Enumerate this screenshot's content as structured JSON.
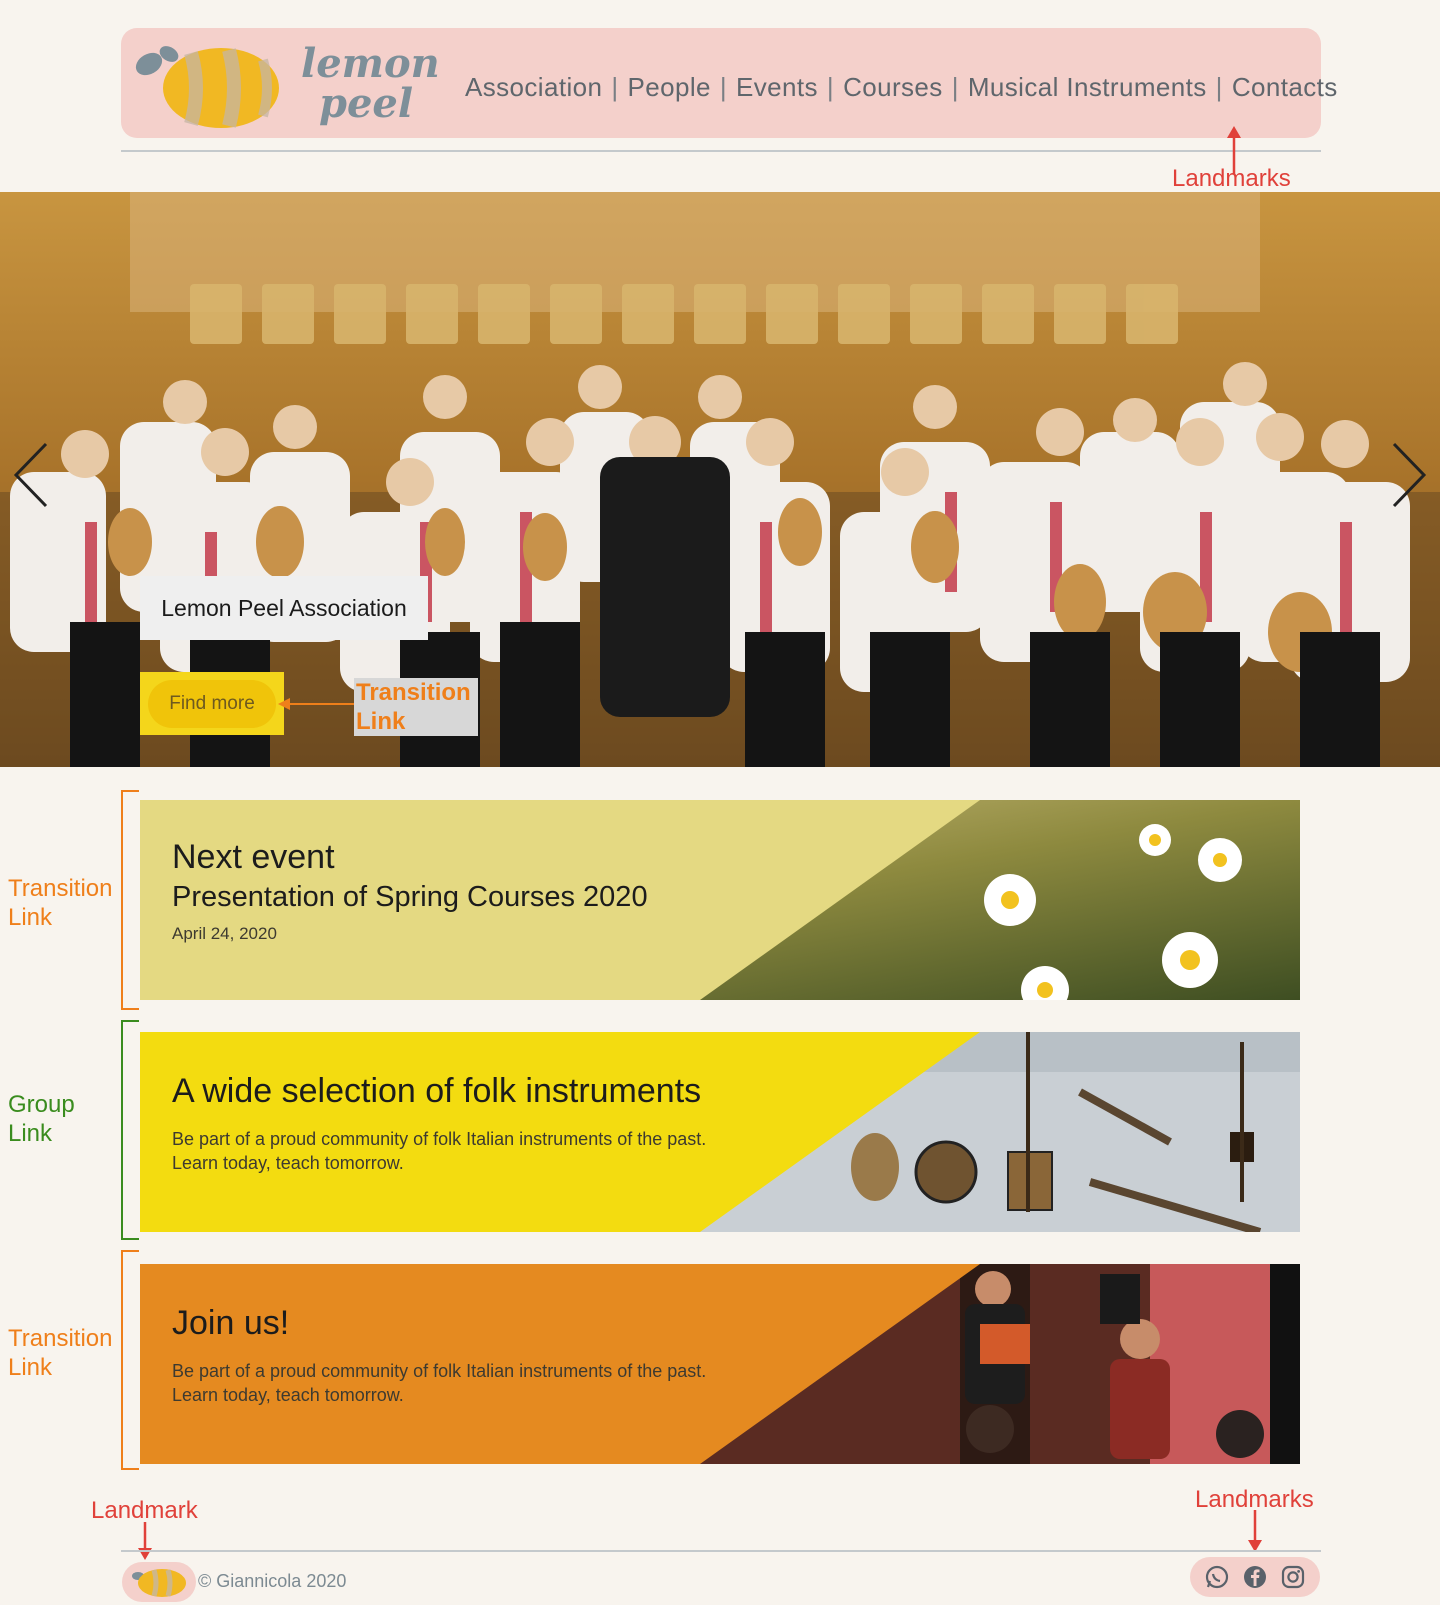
{
  "header": {
    "logo_text_line1": "lemon",
    "logo_text_line2": "peel",
    "nav": [
      "Association",
      "People",
      "Events",
      "Courses",
      "Musical Instruments",
      "Contacts"
    ],
    "separator": "|"
  },
  "hero": {
    "title": "Lemon Peel Association",
    "button_label": "Find more",
    "prev_label": "‹",
    "next_label": "›"
  },
  "cards": [
    {
      "heading": "Next event",
      "subheading": "Presentation of Spring Courses 2020",
      "date": "April 24, 2020",
      "color": "#e4d982"
    },
    {
      "heading": "A wide selection of folk instruments",
      "body_line1": "Be part of a proud community of folk Italian instruments of the past.",
      "body_line2": "Learn today, teach tomorrow.",
      "color": "#f3dc10"
    },
    {
      "heading": "Join us!",
      "body_line1": "Be part of a proud community of folk Italian instruments of the past.",
      "body_line2": "Learn today, teach tomorrow.",
      "color": "#e58a20"
    }
  ],
  "annotations": {
    "landmarks_top": "Landmarks",
    "transition_link_hero_1": "Transition",
    "transition_link_hero_2": "Link",
    "card1_label_1": "Transition",
    "card1_label_2": "Link",
    "card2_label_1": "Group",
    "card2_label_2": "Link",
    "card3_label_1": "Transition",
    "card3_label_2": "Link",
    "landmark_footer_left": "Landmark",
    "landmarks_footer_right": "Landmarks"
  },
  "footer": {
    "copyright": "© Giannicola 2020",
    "social_icons": [
      "whatsapp-icon",
      "facebook-icon",
      "instagram-icon"
    ]
  },
  "colors": {
    "background": "#f8f4ee",
    "header_bg": "#f4d0cb",
    "annotation_orange": "#ef7f1a",
    "annotation_green": "#3a8c1e",
    "annotation_red": "#e0413a"
  }
}
